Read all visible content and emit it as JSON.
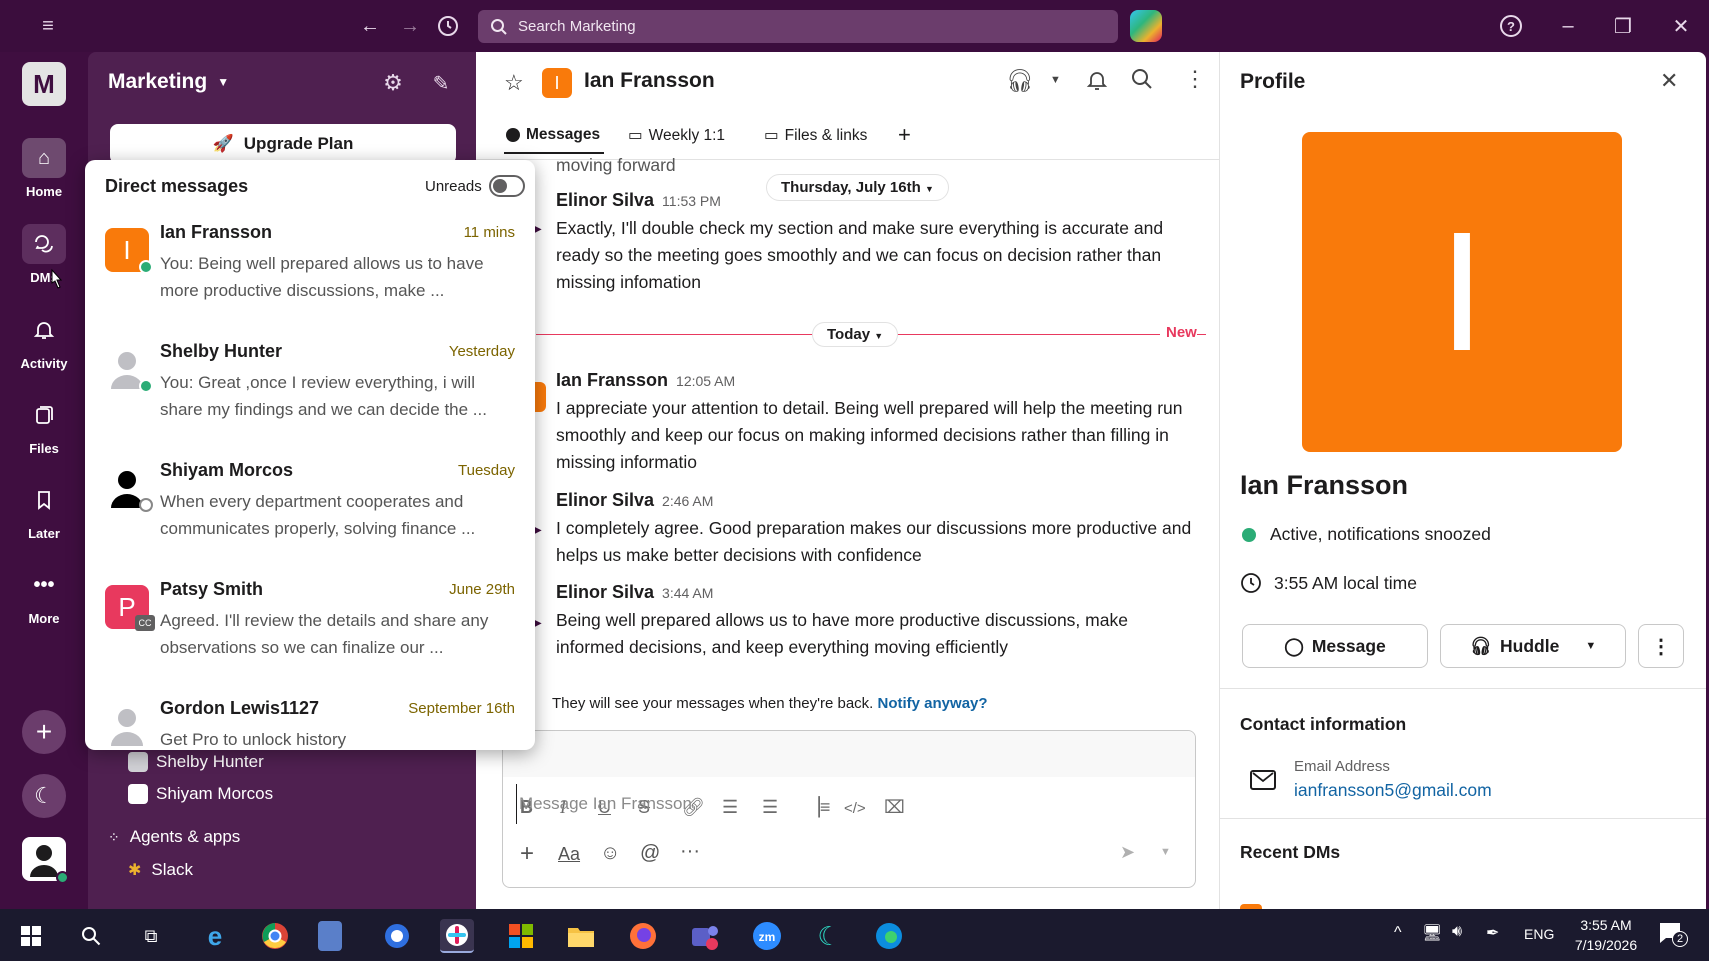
{
  "app": {
    "search_placeholder": "Search Marketing",
    "workspace_initial": "M",
    "workspace_name": "Marketing"
  },
  "rail": [
    {
      "label": "Home"
    },
    {
      "label": "DMs"
    },
    {
      "label": "Activity"
    },
    {
      "label": "Files"
    },
    {
      "label": "Later"
    },
    {
      "label": "More"
    }
  ],
  "sidebar": {
    "upgrade_label": "Upgrade Plan",
    "dm_list": [
      "Shelby Hunter",
      "Shiyam Morcos"
    ],
    "agents_label": "Agents & apps",
    "slack_label": "Slack"
  },
  "dm_popover": {
    "title": "Direct messages",
    "unreads_label": "Unreads",
    "items": [
      {
        "name": "Ian Fransson",
        "time": "11 mins",
        "preview": "You: Being well prepared allows us to have more productive discussions, make ...",
        "avatar": "I",
        "color": "#f97a0b"
      },
      {
        "name": "Shelby Hunter",
        "time": "Yesterday",
        "preview": "You: Great ,once I review everything, i will share my findings and we can decide the ...",
        "avatar": "",
        "color": "#bfbfc4"
      },
      {
        "name": "Shiyam Morcos",
        "time": "Tuesday",
        "preview": "When every department cooperates and communicates properly, solving finance ...",
        "avatar": "",
        "color": "#000000"
      },
      {
        "name": "Patsy Smith",
        "time": "June 29th",
        "preview": "Agreed. I'll review the details and share any observations so we can finalize our ...",
        "avatar": "P",
        "color": "#e8395e"
      },
      {
        "name": "Gordon Lewis1127",
        "time": "September 16th",
        "preview": "Get Pro to unlock history",
        "avatar": "",
        "color": "#bfbfc4"
      }
    ]
  },
  "channel": {
    "name": "Ian Fransson",
    "avatar": "I",
    "tabs": [
      "Messages",
      "Weekly 1:1",
      "Files & links"
    ],
    "partial_top": "moving forward",
    "date_divider_1": "Thursday, July 16th",
    "date_divider_2": "Today",
    "new_label": "New",
    "messages": [
      {
        "name": "Elinor Silva",
        "time": "11:53 PM",
        "text": "Exactly, I'll double check my section and make sure everything is accurate and ready so the meeting goes smoothly and we can focus on decision rather than missing infomation"
      },
      {
        "name": "Ian Fransson",
        "time": "12:05 AM",
        "text": "I appreciate your attention to detail. Being well prepared will help the meeting run smoothly and keep our focus on making informed decisions rather than filling in missing informatio"
      },
      {
        "name": "Elinor Silva",
        "time": "2:46 AM",
        "text": "I completely agree. Good preparation makes our discussions more productive and helps us make better decisions with confidence"
      },
      {
        "name": "Elinor Silva",
        "time": "3:44 AM",
        "text": "Being well prepared allows us to have more productive discussions, make informed decisions, and keep everything moving efficiently"
      }
    ],
    "snooze_notice": "They will see your messages when they're back.",
    "notify_link": "Notify anyway?",
    "composer_placeholder": "Message Ian Fransson"
  },
  "profile": {
    "title": "Profile",
    "avatar_letter": "I",
    "name": "Ian Fransson",
    "status": "Active, notifications snoozed",
    "local_time": "3:55 AM local time",
    "message_button": "Message",
    "huddle_button": "Huddle",
    "contact_heading": "Contact information",
    "email_label": "Email Address",
    "email": "ianfransson5@gmail.com",
    "recent_heading": "Recent DMs"
  },
  "taskbar": {
    "lang": "ENG",
    "time": "3:55 AM",
    "date": "7/19/2026",
    "notif_count": "2"
  },
  "colors": {
    "accent_orange": "#f97a0b",
    "link_blue": "#1264a3",
    "aubergine": "#3f0e40"
  }
}
